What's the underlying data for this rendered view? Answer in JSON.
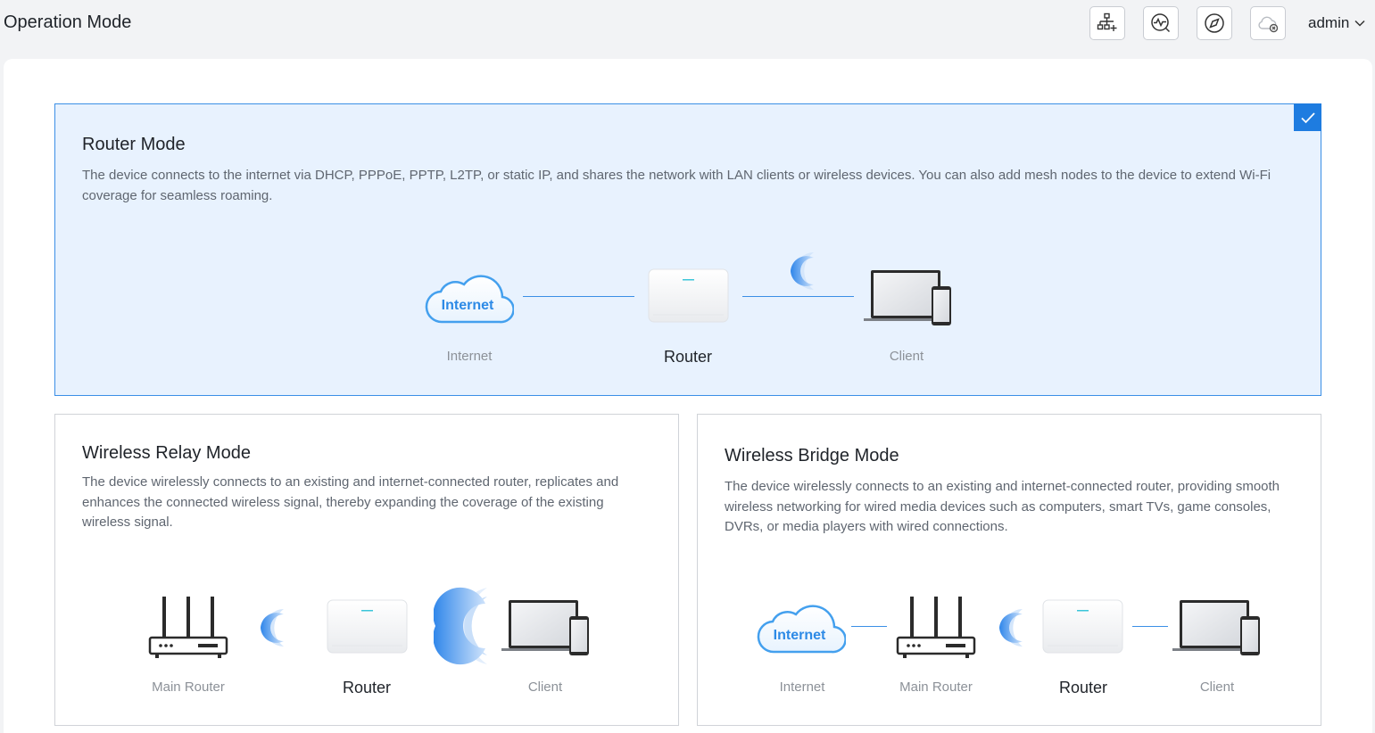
{
  "header": {
    "title": "Operation Mode",
    "user": "admin",
    "tools": [
      {
        "name": "network-add-icon"
      },
      {
        "name": "diagnostics-icon"
      },
      {
        "name": "compass-icon"
      },
      {
        "name": "cloud-disconnected-icon"
      }
    ]
  },
  "modes": {
    "router": {
      "title": "Router Mode",
      "description": "The device connects to the internet via DHCP, PPPoE, PPTP, L2TP, or static IP, and shares the network with LAN clients or wireless devices. You can also add mesh nodes to the device to extend Wi-Fi coverage for seamless roaming.",
      "selected": true,
      "labels": {
        "internet": "Internet",
        "router": "Router",
        "client": "Client"
      },
      "cloud_text": "Internet"
    },
    "relay": {
      "title": "Wireless Relay Mode",
      "description": "The device wirelessly connects to an existing and internet-connected router, replicates and enhances the connected wireless signal, thereby expanding the coverage of the existing wireless signal.",
      "labels": {
        "main_router": "Main Router",
        "router": "Router",
        "client": "Client"
      }
    },
    "bridge": {
      "title": "Wireless Bridge Mode",
      "description": "The device wirelessly connects to an existing and internet-connected router, providing smooth wireless networking for wired media devices such as computers, smart TVs, game consoles, DVRs, or media players with wired connections.",
      "labels": {
        "internet": "Internet",
        "main_router": "Main Router",
        "router": "Router",
        "client": "Client"
      },
      "cloud_text": "Internet"
    }
  },
  "colors": {
    "accent": "#1e7ce0",
    "selected_bg": "#e8f2fe",
    "link": "#3b8fe6"
  }
}
